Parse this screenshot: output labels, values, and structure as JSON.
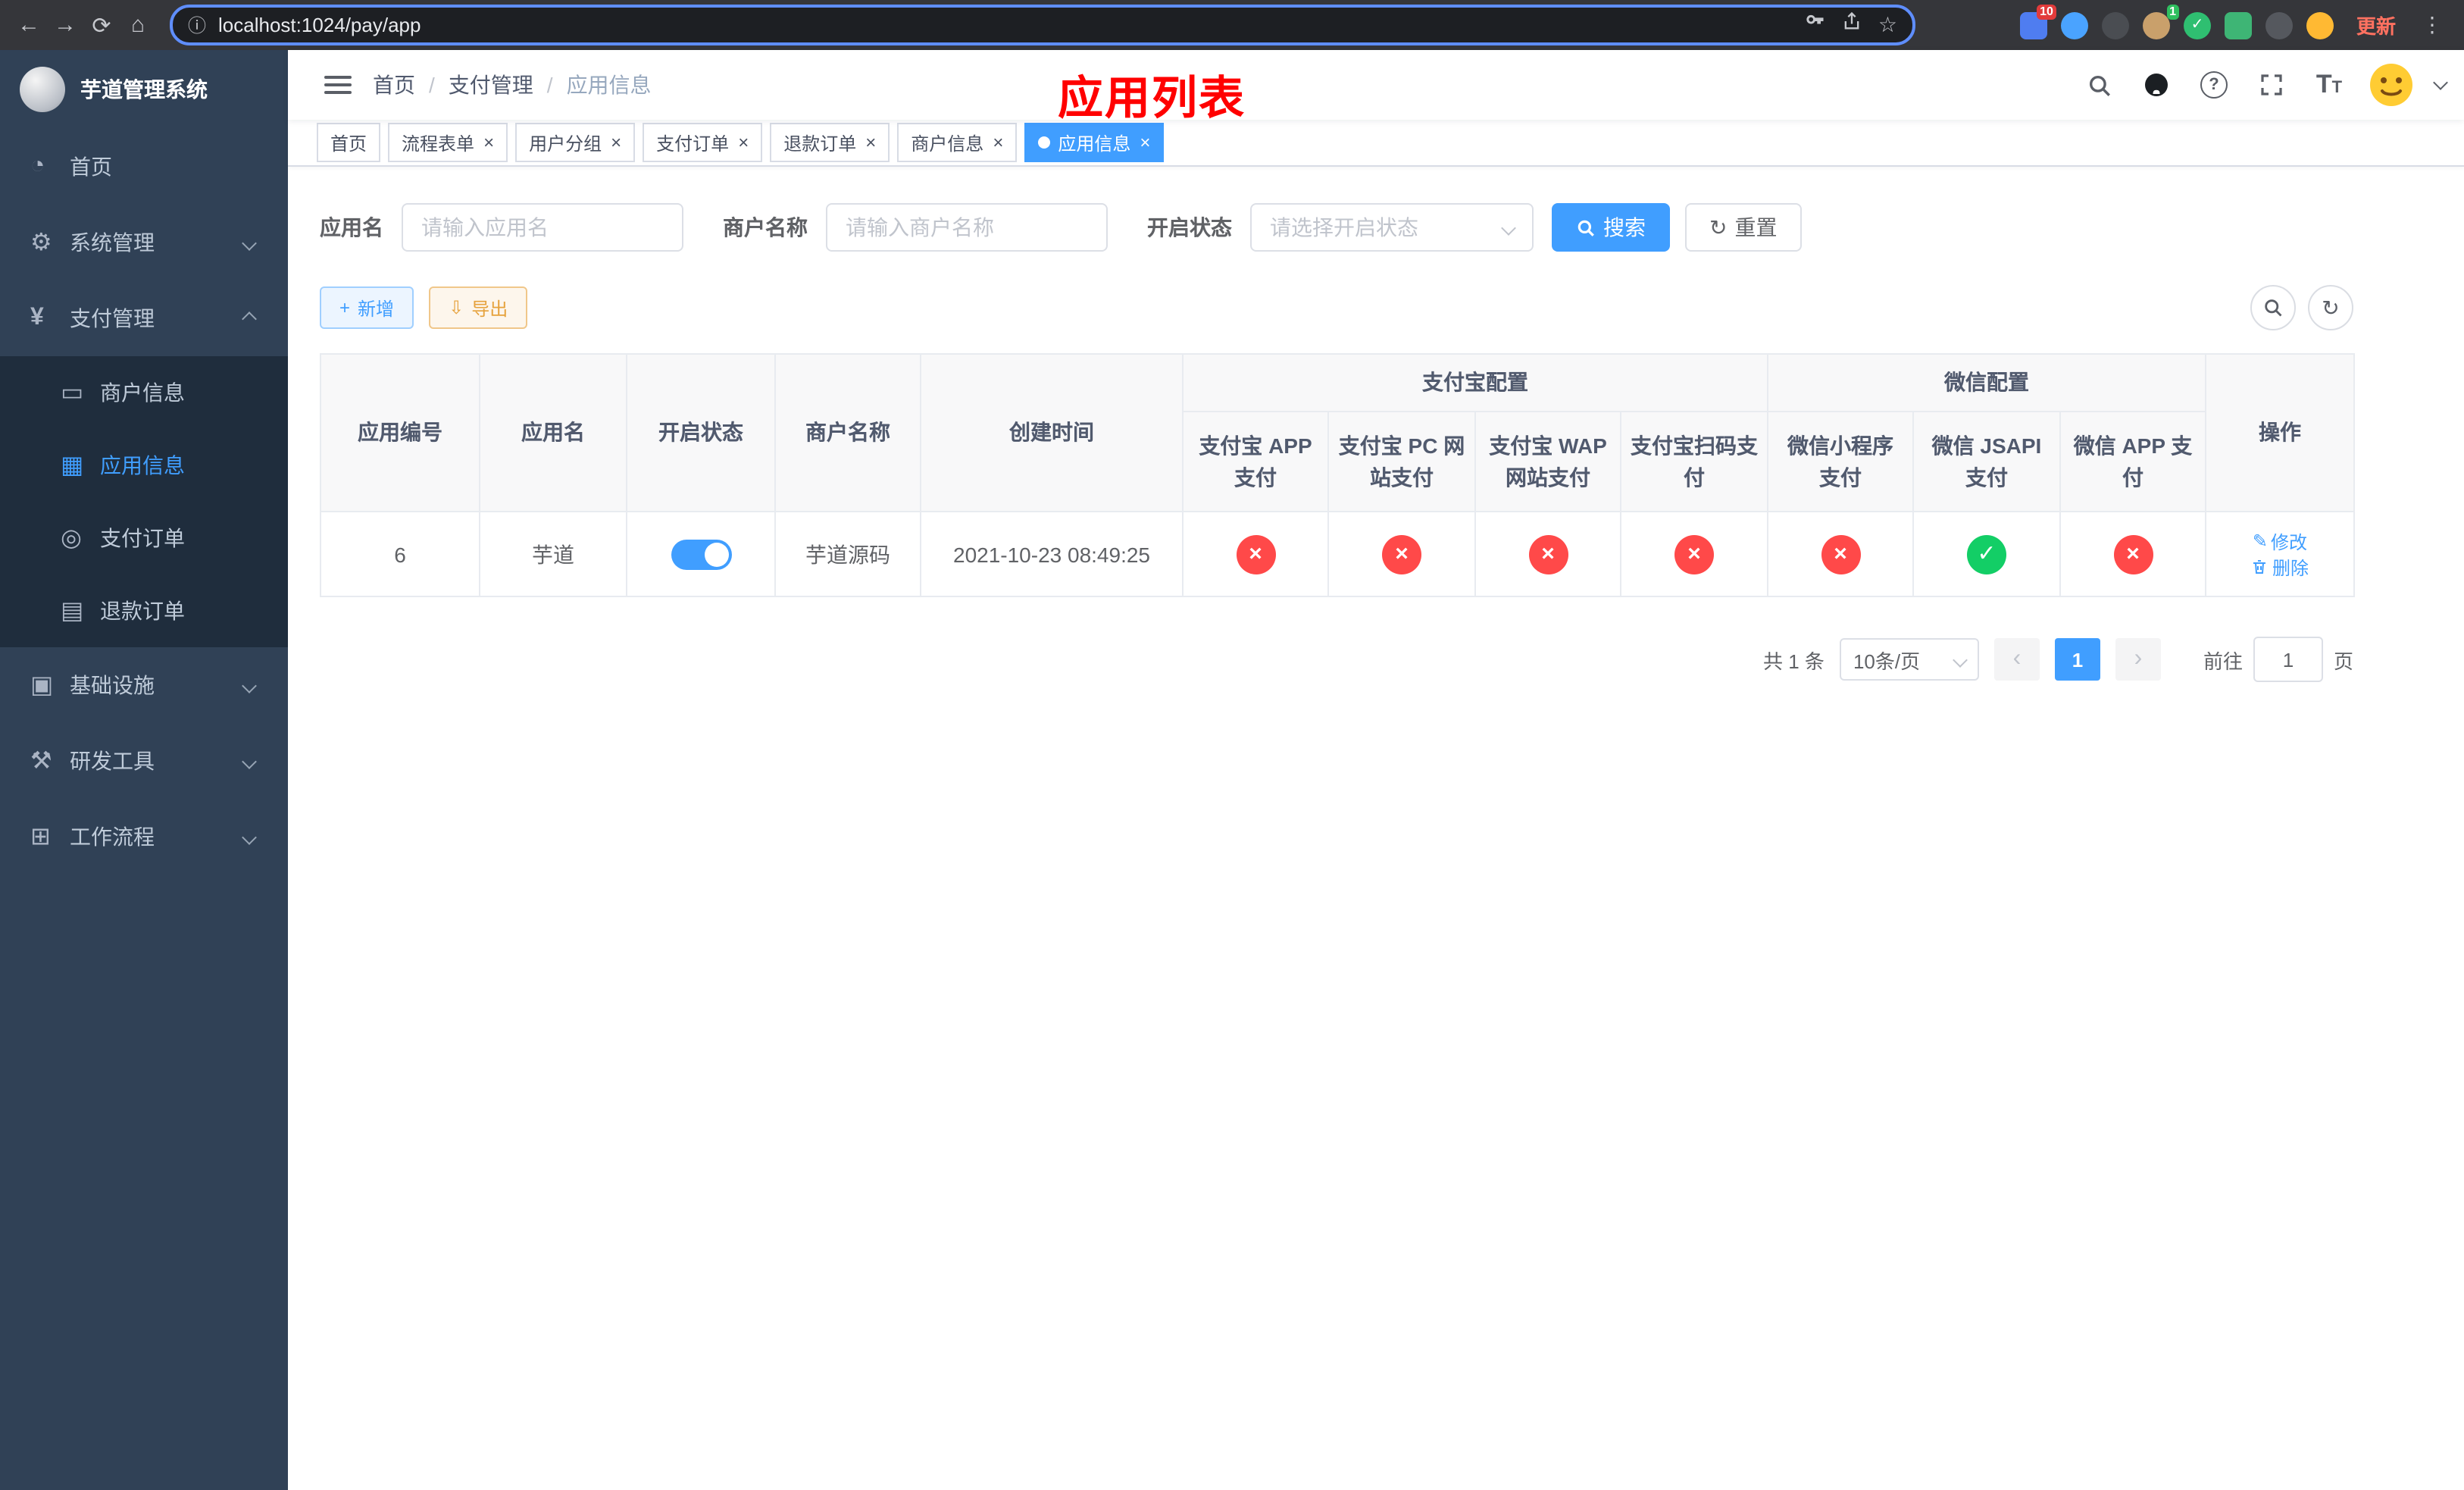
{
  "browser": {
    "url": "localhost:1024/pay/app",
    "update_button": "更新",
    "ext_badge_blue": "10",
    "ext_badge_green": "1"
  },
  "app": {
    "name": "芋道管理系统",
    "annotation": "应用列表"
  },
  "colors": {
    "primary": "#409eff",
    "success": "#13ce66",
    "danger": "#ff4949",
    "warning": "#e6a23c",
    "annotation": "#ff0000",
    "sidebar_bg": "#304156",
    "submenu_bg": "#1f2d3d"
  },
  "sidebar": {
    "items": [
      {
        "label": "首页"
      },
      {
        "label": "系统管理"
      },
      {
        "label": "支付管理"
      },
      {
        "label": "基础设施"
      },
      {
        "label": "研发工具"
      },
      {
        "label": "工作流程"
      }
    ],
    "payment_submenu": [
      {
        "label": "商户信息"
      },
      {
        "label": "应用信息"
      },
      {
        "label": "支付订单"
      },
      {
        "label": "退款订单"
      }
    ]
  },
  "breadcrumb": {
    "items": [
      "首页",
      "支付管理",
      "应用信息"
    ],
    "separator": "/"
  },
  "tabs": [
    {
      "label": "首页"
    },
    {
      "label": "流程表单"
    },
    {
      "label": "用户分组"
    },
    {
      "label": "支付订单"
    },
    {
      "label": "退款订单"
    },
    {
      "label": "商户信息"
    },
    {
      "label": "应用信息"
    }
  ],
  "filters": {
    "app_name_label": "应用名",
    "app_name_placeholder": "请输入应用名",
    "merchant_label": "商户名称",
    "merchant_placeholder": "请输入商户名称",
    "status_label": "开启状态",
    "status_placeholder": "请选择开启状态",
    "search_button": "搜索",
    "reset_button": "重置"
  },
  "toolbar": {
    "add_button": "新增",
    "export_button": "导出"
  },
  "table": {
    "headers": {
      "app_id": "应用编号",
      "app_name": "应用名",
      "status": "开启状态",
      "merchant": "商户名称",
      "create_time": "创建时间",
      "alipay_group": "支付宝配置",
      "wechat_group": "微信配置",
      "alipay_app": "支付宝 APP 支付",
      "alipay_pc": "支付宝 PC 网站支付",
      "alipay_wap": "支付宝 WAP 网站支付",
      "alipay_qr": "支付宝扫码支付",
      "wx_mini": "微信小程序支付",
      "wx_jsapi": "微信 JSAPI 支付",
      "wx_app": "微信 APP 支付",
      "actions": "操作"
    },
    "rows": [
      {
        "app_id": "6",
        "app_name": "芋道",
        "status_on": true,
        "merchant": "芋道源码",
        "create_time": "2021-10-23 08:49:25",
        "channels": [
          "no",
          "no",
          "no",
          "no",
          "no",
          "yes",
          "no"
        ],
        "edit": "修改",
        "delete": "删除"
      }
    ]
  },
  "pagination": {
    "total": "共 1 条",
    "page_size": "10条/页",
    "current_page": "1",
    "goto_prefix": "前往",
    "goto_value": "1",
    "goto_suffix": "页"
  }
}
